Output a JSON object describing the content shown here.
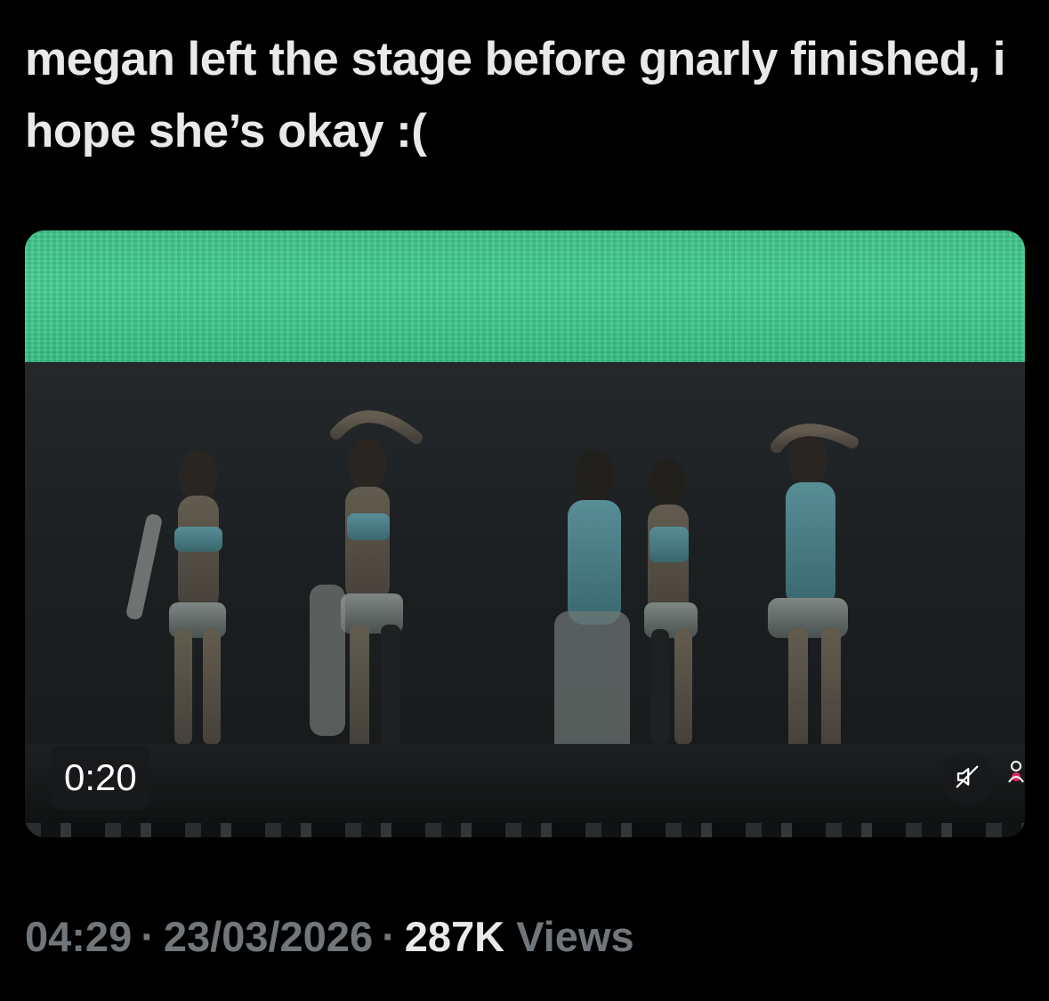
{
  "tweet": {
    "text": "megan left the stage before gnarly finished, i hope she’s okay :(",
    "time": "04:29",
    "separator": "·",
    "date": "23/03/2026",
    "views_count": "287K",
    "views_label": "Views"
  },
  "video": {
    "duration": "0:20",
    "muted": true,
    "icons": {
      "mute": "speaker-muted-icon",
      "recording": "recording-dot-icon",
      "person": "person-icon"
    }
  },
  "colors": {
    "background": "#000000",
    "text_primary": "#e7e9ea",
    "text_secondary": "#71767b",
    "screen_green": "#44cc90",
    "recording_red": "#e0245e"
  }
}
